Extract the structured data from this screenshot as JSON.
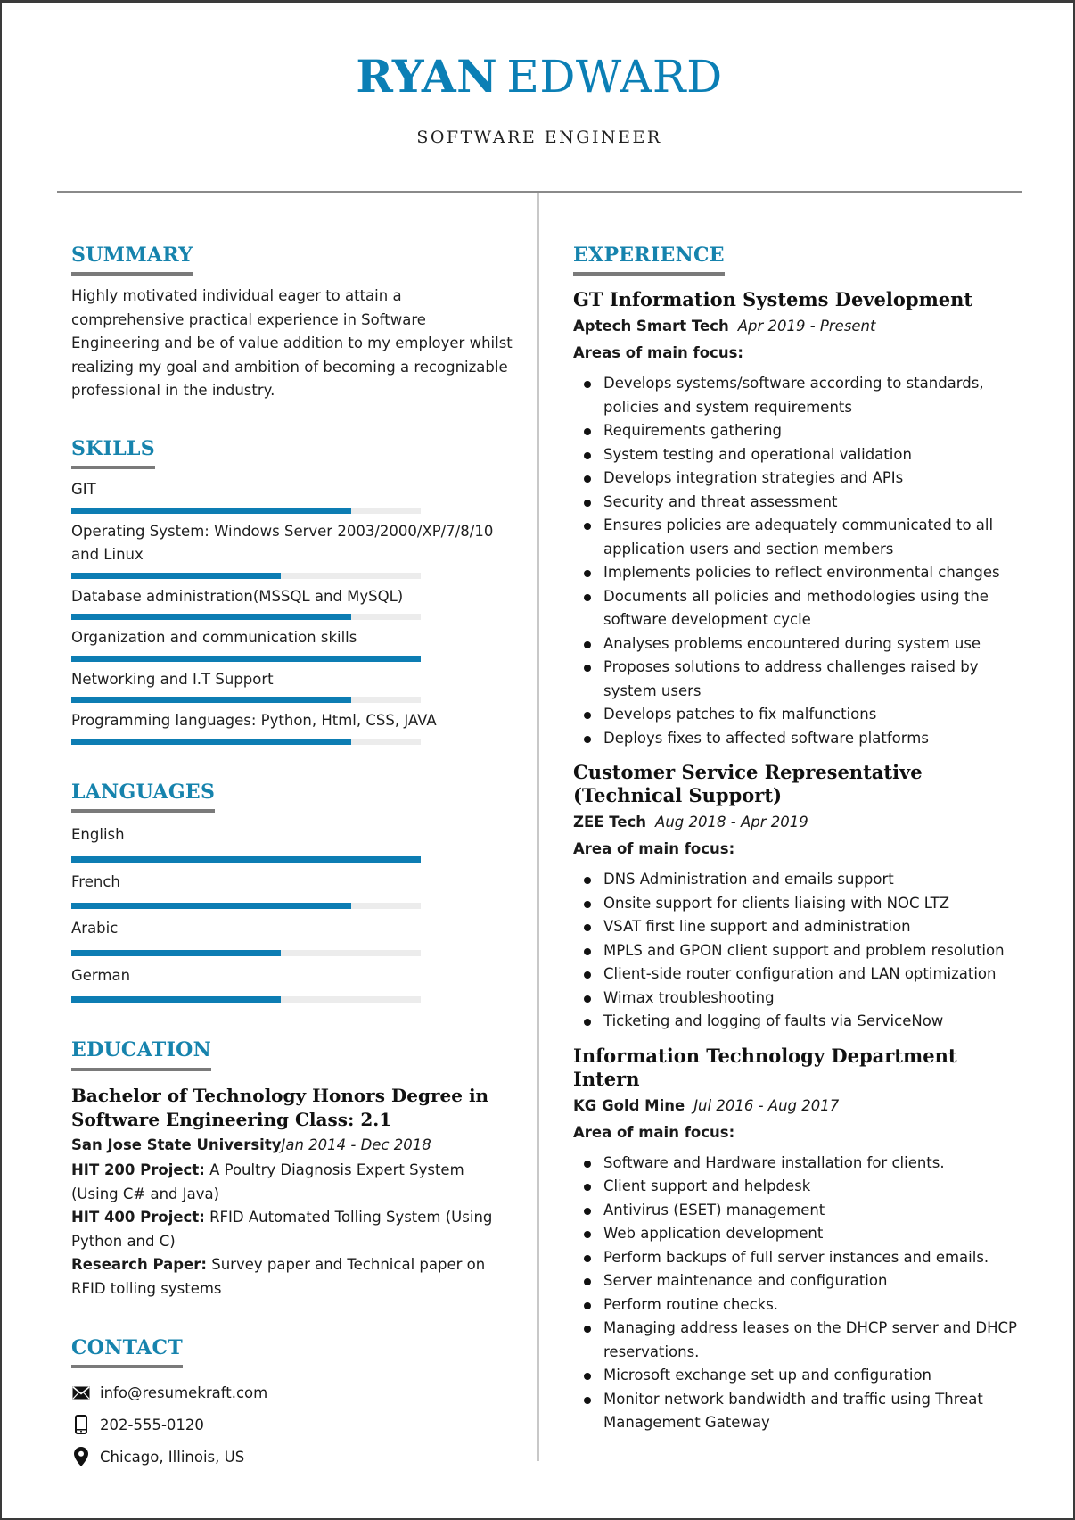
{
  "header": {
    "first_name": "RYAN",
    "last_name": "EDWARD",
    "title": "SOFTWARE ENGINEER"
  },
  "colors": {
    "accent": "#0d7db3",
    "heading": "#1683ad",
    "rule": "#7a7a7a",
    "bar_track": "#ececec"
  },
  "summary": {
    "heading": "SUMMARY",
    "text": "Highly motivated individual eager to attain a comprehensive practical experience in Software Engineering and be of value addition to my employer whilst realizing my goal and ambition of becoming a recognizable professional in the industry."
  },
  "skills": {
    "heading": "SKILLS",
    "items": [
      {
        "label": "GIT",
        "level": 0.8
      },
      {
        "label": "Operating System: Windows Server 2003/2000/XP/7/8/10 and Linux",
        "level": 0.6
      },
      {
        "label": "Database administration(MSSQL and MySQL)",
        "level": 0.8
      },
      {
        "label": "Organization and communication skills",
        "level": 1.0
      },
      {
        "label": "Networking and I.T Support",
        "level": 0.8
      },
      {
        "label": "Programming languages: Python, Html, CSS, JAVA",
        "level": 0.8
      }
    ]
  },
  "languages": {
    "heading": "LANGUAGES",
    "items": [
      {
        "label": "English",
        "level": 1.0
      },
      {
        "label": "French",
        "level": 0.8
      },
      {
        "label": "Arabic",
        "level": 0.6
      },
      {
        "label": "German",
        "level": 0.6
      }
    ]
  },
  "education": {
    "heading": "EDUCATION",
    "degree": "Bachelor of Technology Honors Degree in Software Engineering Class: 2.1",
    "school": "San Jose State University",
    "dates": "Jan 2014 - Dec 2018",
    "projects": [
      {
        "label": "HIT 200 Project:",
        "text": " A Poultry Diagnosis Expert System (Using C# and Java)"
      },
      {
        "label": "HIT 400 Project:",
        "text": " RFID Automated Tolling System (Using Python and C)"
      },
      {
        "label": "Research Paper:",
        "text": " Survey paper and Technical paper on RFID tolling systems"
      }
    ]
  },
  "contact": {
    "heading": "CONTACT",
    "items": [
      {
        "icon": "envelope-icon",
        "text": "info@resumekraft.com"
      },
      {
        "icon": "mobile-phone-icon",
        "text": "202-555-0120"
      },
      {
        "icon": "map-pin-icon",
        "text": "Chicago, Illinois, US"
      }
    ]
  },
  "experience": {
    "heading": "EXPERIENCE",
    "jobs": [
      {
        "title": "GT Information Systems Development",
        "company": "Aptech Smart Tech",
        "dates": "Apr 2019 - Present",
        "focus_label": "Areas of main focus:",
        "bullets": [
          "Develops systems/software according to standards, policies and system requirements",
          "Requirements gathering",
          "System testing and operational validation",
          "Develops integration strategies and APIs",
          "Security and threat assessment",
          "Ensures policies are adequately communicated to all application users and section members",
          "Implements policies to reflect environmental changes",
          "Documents all policies and methodologies using the software development cycle",
          "Analyses problems encountered during system use",
          "Proposes solutions to address challenges raised by system users",
          "Develops patches to fix malfunctions",
          "Deploys fixes to affected software platforms"
        ]
      },
      {
        "title": "Customer Service Representative (Technical Support)",
        "company": "ZEE Tech",
        "dates": "Aug 2018 - Apr 2019",
        "focus_label": "Area of main focus:",
        "bullets": [
          "DNS Administration and emails support",
          "Onsite support for clients liaising with NOC LTZ",
          "VSAT first line support and administration",
          "MPLS and GPON client support and problem resolution",
          "Client-side router configuration and LAN optimization",
          "Wimax troubleshooting",
          "Ticketing and logging of faults via ServiceNow"
        ]
      },
      {
        "title": "Information Technology Department Intern",
        "company": "KG Gold Mine",
        "dates": "Jul 2016 - Aug 2017",
        "focus_label": "Area of main focus:",
        "bullets": [
          "Software and Hardware installation for clients.",
          "Client support and helpdesk",
          "Antivirus (ESET) management",
          "Web application development",
          "Perform backups of full server instances and emails.",
          "Server maintenance and configuration",
          "Perform routine checks.",
          "Managing address leases on the DHCP server and DHCP reservations.",
          "Microsoft exchange set up and configuration",
          "Monitor network bandwidth and traffic using Threat Management Gateway"
        ]
      }
    ]
  }
}
